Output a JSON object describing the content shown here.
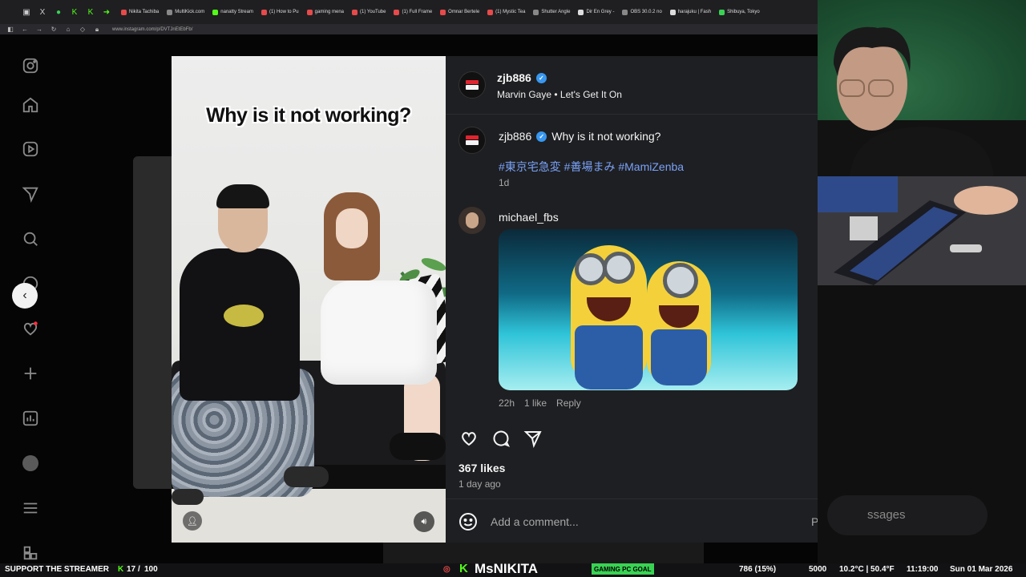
{
  "browser": {
    "bookmarks": [
      {
        "label": "Nikita Tachiba",
        "color": "#e74a4a"
      },
      {
        "label": "MultiKick.com",
        "color": "#888888"
      },
      {
        "label": "nanatty Stream",
        "color": "#53fc18"
      },
      {
        "label": "(1) How to Pu",
        "color": "#e74a4a"
      },
      {
        "label": "gaming mena",
        "color": "#e74a4a"
      },
      {
        "label": "(1) YouTube",
        "color": "#e74a4a"
      },
      {
        "label": "(1) Full Frame",
        "color": "#e74a4a"
      },
      {
        "label": "Omnar Bertele",
        "color": "#e74a4a"
      },
      {
        "label": "(1) Mystic Tea",
        "color": "#e74a4a"
      },
      {
        "label": "Shutter Angle",
        "color": "#888888"
      },
      {
        "label": "Dir En Grey -",
        "color": "#dddddd"
      },
      {
        "label": "OBS 30.0.2 no",
        "color": "#888888"
      },
      {
        "label": "harajuku | Fash",
        "color": "#dddddd"
      },
      {
        "label": "Shibuya, Tokyo",
        "color": "#39d353"
      }
    ],
    "url": "www.instagram.com/p/DVTJnEtEbFb/"
  },
  "video": {
    "caption": "Why is it not working?"
  },
  "post": {
    "username": "zjb886",
    "music": "Marvin Gaye • Let's Get It On",
    "caption_user": "zjb886",
    "caption_text": "Why is it not working?",
    "hashtags": "#東京宅急変 #善場まみ #MamiZenba",
    "caption_time": "1d",
    "comment": {
      "username": "michael_fbs",
      "time": "22h",
      "likes": "1 like",
      "reply": "Reply"
    },
    "likes": "367 likes",
    "posted": "1 day ago",
    "comment_placeholder": "Add a comment...",
    "post_label": "Post"
  },
  "stream": {
    "messages_label": "ssages",
    "support": "SUPPORT THE STREAMER",
    "sub_count": "17",
    "sub_goal": "100",
    "streamer_name": "MsNIKITA",
    "goal_label": "GAMING PC GOAL",
    "goal_progress": "786 (15%)",
    "goal_target": "5000",
    "weather": "10.2°C | 50.4°F",
    "clock": "11:19:00",
    "date": "Sun 01 Mar 2026"
  },
  "colors": {
    "panel_bg": "#1e1f22",
    "link": "#7aa2f7",
    "verified": "#3897f0",
    "kick_green": "#53fc18"
  }
}
